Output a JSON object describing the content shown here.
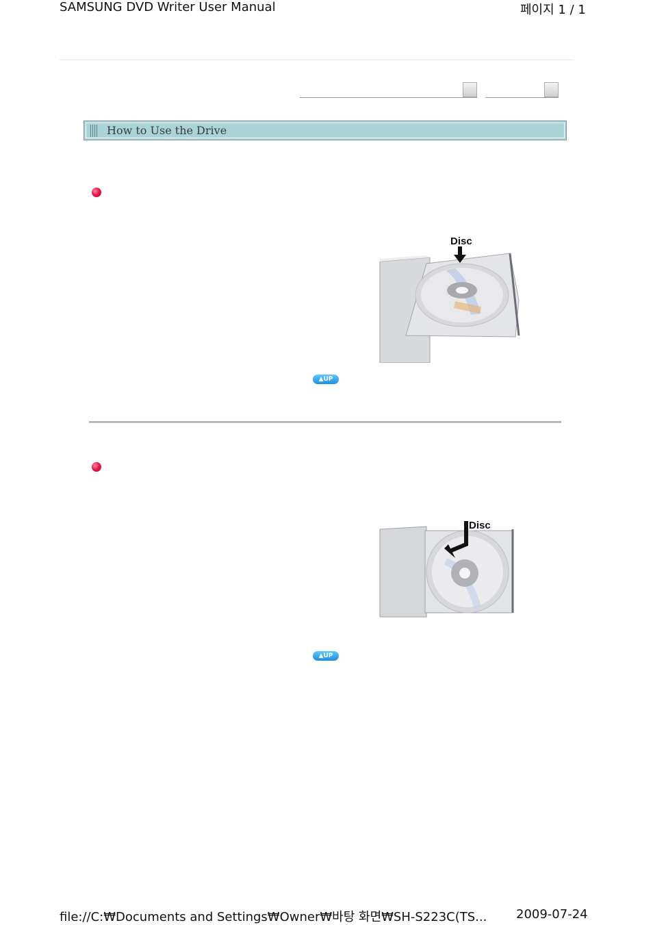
{
  "print_header": {
    "title": "SAMSUNG DVD Writer User Manual",
    "page": "페이지 1 / 1"
  },
  "page_title": "How to Use the Drive",
  "sections": [
    {
      "figure_label": "Disc",
      "up_label": "▲UP"
    },
    {
      "figure_label": "Disc",
      "up_label": "▲UP"
    }
  ],
  "print_footer": {
    "path": "file://C:₩Documents and Settings₩Owner₩바탕 화면₩SH-S223C(TS...",
    "date": "2009-07-24"
  },
  "colors": {
    "title_bar_bg": "#a9d3d6",
    "bullet": "#e8194d",
    "up_button": "#1b8fe0"
  }
}
